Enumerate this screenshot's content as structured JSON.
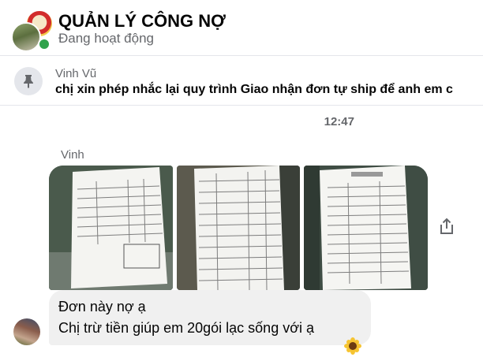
{
  "header": {
    "title": "QUẢN LÝ CÔNG NỢ",
    "status": "Đang hoạt động"
  },
  "pinned": {
    "sender": "Vinh Vũ",
    "text": "chị xin phép nhắc lại quy trình Giao nhận đơn tự ship để anh em c"
  },
  "timestamp": "12:47",
  "message": {
    "sender": "Vinh",
    "photo_count": 3,
    "lines": [
      "Đơn này nợ ạ",
      "Chị trừ tiền giúp em 20gói lạc sống với ạ"
    ],
    "reaction": "sunflower"
  },
  "icons": {
    "pin": "pushpin-icon",
    "share": "share-icon",
    "reaction": "sunflower-icon"
  },
  "colors": {
    "online": "#31a24c",
    "secondary_text": "#65676b",
    "bubble": "#f0f0f0"
  }
}
